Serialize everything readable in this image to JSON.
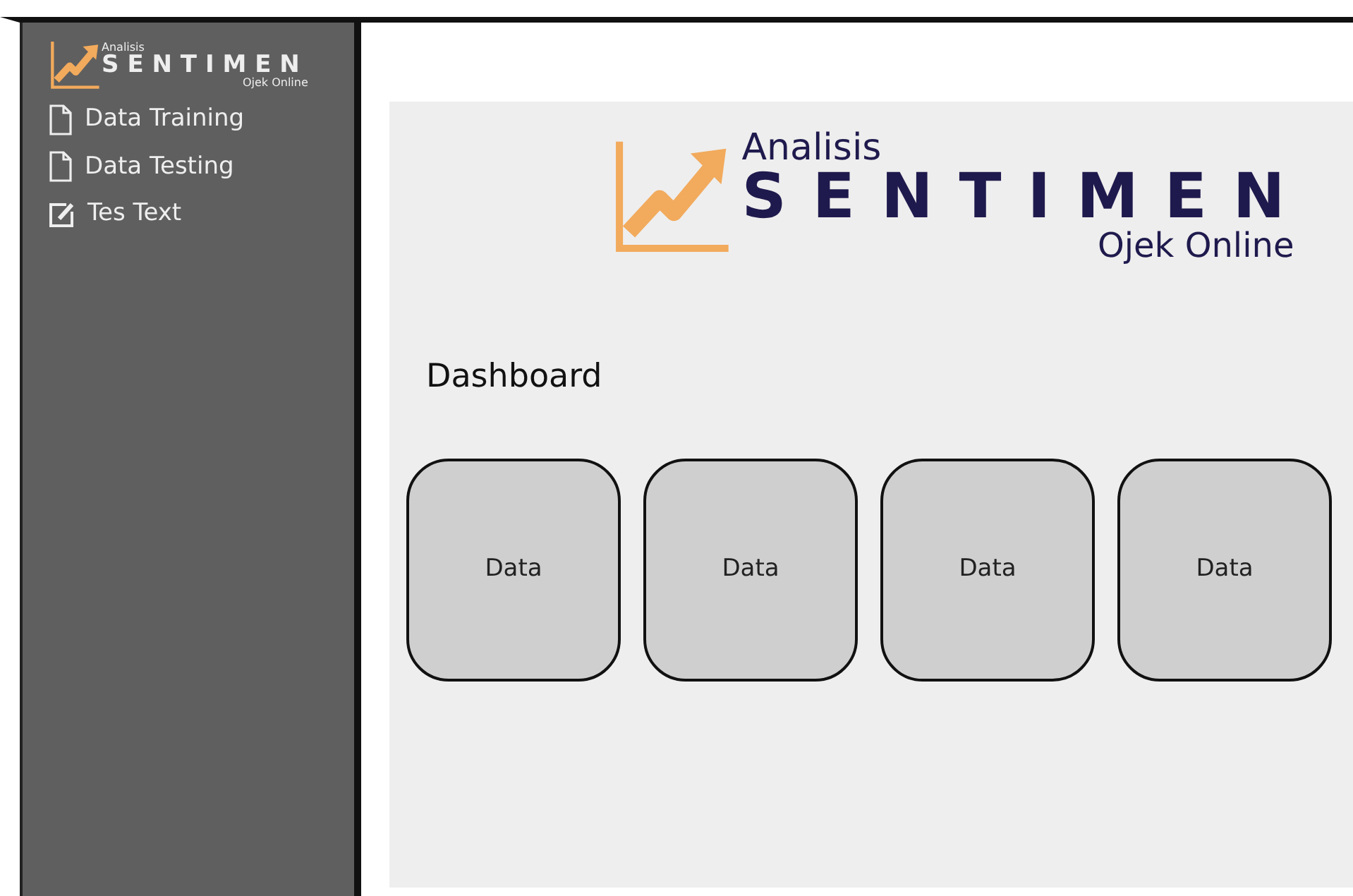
{
  "sidebar": {
    "logo": {
      "top": "Analisis",
      "main": "SENTIMEN",
      "bottom": "Ojek Online"
    },
    "items": [
      {
        "label": "Data Training",
        "kind": "file"
      },
      {
        "label": "Data Testing",
        "kind": "file"
      },
      {
        "label": "Tes Text",
        "kind": "edit"
      }
    ]
  },
  "header_logo": {
    "top": "Analisis",
    "main": "SENTIMEN",
    "bottom": "Ojek Online"
  },
  "page_title": "Dashboard",
  "cards": [
    {
      "label": "Data"
    },
    {
      "label": "Data"
    },
    {
      "label": "Data"
    },
    {
      "label": "Data"
    }
  ]
}
